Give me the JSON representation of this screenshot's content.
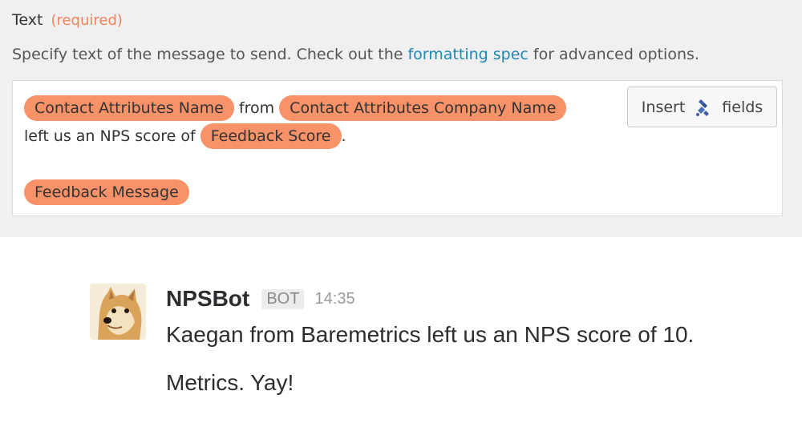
{
  "form": {
    "label": "Text",
    "required": "(required)",
    "help_prefix": "Specify text of the message to send. Check out the",
    "help_link": "formatting spec",
    "help_suffix": "for advanced options.",
    "insert_button": {
      "label_before": "Insert",
      "label_after": "fields",
      "icon": "zapier-fields-icon"
    },
    "editor": {
      "line1": {
        "pill1": "Contact Attributes Name",
        "text1": "from",
        "pill2": "Contact Attributes Company Name"
      },
      "line2": {
        "text1": "left us an NPS score of",
        "pill1": "Feedback Score",
        "text2": "."
      },
      "line3": {
        "pill1": "Feedback Message"
      }
    },
    "colors": {
      "pill": "#f99268",
      "required": "#f0845a",
      "link": "#1e88b4"
    }
  },
  "message": {
    "username": "NPSBot",
    "badge": "BOT",
    "time": "14:35",
    "lines": [
      "Kaegan from Baremetrics left us an NPS score of 10.",
      "Metrics. Yay!"
    ],
    "avatar": "doge-avatar"
  }
}
